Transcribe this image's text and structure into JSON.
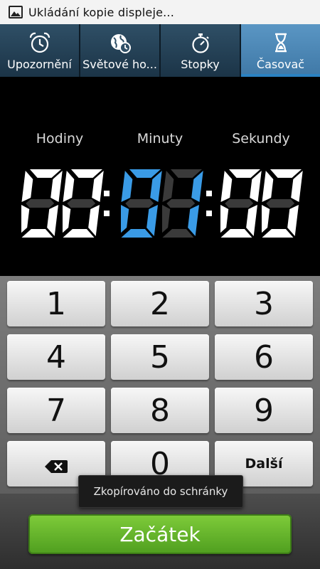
{
  "status_bar": {
    "text": "Ukládání kopie displeje..."
  },
  "tabs": [
    {
      "label": "Upozornění",
      "icon": "alarm-clock-icon",
      "active": false
    },
    {
      "label": "Světové ho...",
      "icon": "world-clock-icon",
      "active": false
    },
    {
      "label": "Stopky",
      "icon": "stopwatch-icon",
      "active": false
    },
    {
      "label": "Časovač",
      "icon": "hourglass-icon",
      "active": true
    }
  ],
  "timer": {
    "units": {
      "hours": "Hodiny",
      "minutes": "Minuty",
      "seconds": "Sekundy"
    },
    "hours": "00",
    "minutes": "01",
    "seconds": "00",
    "active_field": "minutes",
    "colors": {
      "digit": "#ffffff",
      "active_digit": "#3a9be6",
      "inactive_segment": "#3a3a3a"
    }
  },
  "keypad": {
    "keys": [
      "1",
      "2",
      "3",
      "4",
      "5",
      "6",
      "7",
      "8",
      "9",
      "",
      "0",
      "Další"
    ],
    "backspace_icon": "backspace-icon"
  },
  "toast": {
    "text": "Zkopírováno do schránky"
  },
  "start_button": {
    "label": "Začátek",
    "color": "#62b52a"
  }
}
